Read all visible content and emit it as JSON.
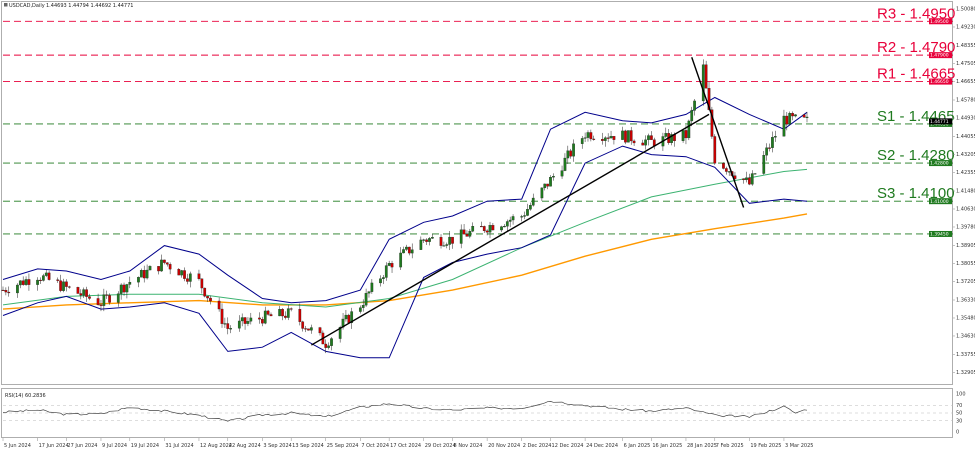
{
  "header": {
    "symbol": "USDCAD,Daily",
    "ohlc": "1.44693 1.44794 1.44692 1.44771",
    "rsi_label": "RSI(14) 60.2836"
  },
  "colors": {
    "resistance": "#e8003a",
    "support": "#1f7a1f",
    "up_candle": "#1f7a1f",
    "down_candle": "#cc0000",
    "bollinger": "#00008b",
    "ma_fast": "#3cb371",
    "ma_slow": "#ff9900",
    "trendline": "#000000",
    "rsi_line": "#444444"
  },
  "chart_data": [
    {
      "type": "candlestick",
      "title": "USDCAD,Daily",
      "ylim": [
        1.3255,
        1.5008
      ],
      "price_axis_ticks": [
        "1.50080",
        "1.49230",
        "1.48355",
        "1.47505",
        "1.46655",
        "1.45780",
        "1.44930",
        "1.44055",
        "1.43205",
        "1.42355",
        "1.41480",
        "1.40630",
        "1.39780",
        "1.38905",
        "1.38055",
        "1.37205",
        "1.36330",
        "1.35480",
        "1.34630",
        "1.33755",
        "1.32905",
        "1.32055"
      ],
      "x_axis_labels": [
        "5 Jun 2024",
        "17 Jun 2024",
        "27 Jun 2024",
        "9 Jul 2024",
        "19 Jul 2024",
        "31 Jul 2024",
        "12 Aug 2024",
        "22 Aug 2024",
        "3 Sep 2024",
        "13 Sep 2024",
        "25 Sep 2024",
        "7 Oct 2024",
        "17 Oct 2024",
        "29 Oct 2024",
        "8 Nov 2024",
        "20 Nov 2024",
        "2 Dec 2024",
        "12 Dec 2024",
        "24 Dec 2024",
        "6 Jan 2025",
        "16 Jan 2025",
        "28 Jan 2025",
        "7 Feb 2025",
        "19 Feb 2025",
        "3 Mar 2025"
      ],
      "levels": [
        {
          "name": "R3",
          "label": "R3 - 1.4950",
          "value": 1.495,
          "tag": "1.49500",
          "kind": "resistance"
        },
        {
          "name": "R2",
          "label": "R2 - 1.4790",
          "value": 1.479,
          "tag": "1.47900",
          "kind": "resistance"
        },
        {
          "name": "R1",
          "label": "R1 - 1.4665",
          "value": 1.4665,
          "tag": "1.46650",
          "kind": "resistance"
        },
        {
          "name": "S1",
          "label": "S1 - 1.4465",
          "value": 1.4465,
          "tag": "1.44650",
          "kind": "support"
        },
        {
          "name": "S2",
          "label": "S2 - 1.4280",
          "value": 1.428,
          "tag": "1.42800",
          "kind": "support"
        },
        {
          "name": "S3",
          "label": "S3 - 1.4100",
          "value": 1.41,
          "tag": "1.41000",
          "kind": "support"
        },
        {
          "name": "L4",
          "label": "",
          "value": 1.3945,
          "tag": "1.39450",
          "kind": "support"
        }
      ],
      "current_price_tag": "1.44771",
      "price_path": [
        [
          "5 Jun 2024",
          1.368
        ],
        [
          "17 Jun 2024",
          1.375
        ],
        [
          "27 Jun 2024",
          1.369
        ],
        [
          "9 Jul 2024",
          1.362
        ],
        [
          "19 Jul 2024",
          1.372
        ],
        [
          "31 Jul 2024",
          1.381
        ],
        [
          "12 Aug 2024",
          1.372
        ],
        [
          "22 Aug 2024",
          1.35
        ],
        [
          "3 Sep 2024",
          1.355
        ],
        [
          "13 Sep 2024",
          1.357
        ],
        [
          "25 Sep 2024",
          1.343
        ],
        [
          "7 Oct 2024",
          1.361
        ],
        [
          "17 Oct 2024",
          1.38
        ],
        [
          "29 Oct 2024",
          1.392
        ],
        [
          "8 Nov 2024",
          1.392
        ],
        [
          "20 Nov 2024",
          1.398
        ],
        [
          "2 Dec 2024",
          1.403
        ],
        [
          "12 Dec 2024",
          1.42
        ],
        [
          "24 Dec 2024",
          1.442
        ],
        [
          "6 Jan 2025",
          1.441
        ],
        [
          "16 Jan 2025",
          1.438
        ],
        [
          "28 Jan 2025",
          1.441
        ],
        [
          "3 Feb 2025",
          1.473
        ],
        [
          "7 Feb 2025",
          1.43
        ],
        [
          "19 Feb 2025",
          1.418
        ],
        [
          "3 Mar 2025",
          1.449
        ],
        [
          "11 Mar 2025",
          1.4477
        ]
      ],
      "bollinger_upper": [
        [
          "5 Jun 2024",
          1.373
        ],
        [
          "17 Jun 2024",
          1.378
        ],
        [
          "27 Jun 2024",
          1.377
        ],
        [
          "9 Jul 2024",
          1.373
        ],
        [
          "19 Jul 2024",
          1.377
        ],
        [
          "31 Jul 2024",
          1.389
        ],
        [
          "12 Aug 2024",
          1.385
        ],
        [
          "22 Aug 2024",
          1.375
        ],
        [
          "3 Sep 2024",
          1.364
        ],
        [
          "13 Sep 2024",
          1.362
        ],
        [
          "25 Sep 2024",
          1.363
        ],
        [
          "7 Oct 2024",
          1.368
        ],
        [
          "17 Oct 2024",
          1.392
        ],
        [
          "29 Oct 2024",
          1.4
        ],
        [
          "8 Nov 2024",
          1.403
        ],
        [
          "20 Nov 2024",
          1.41
        ],
        [
          "2 Dec 2024",
          1.411
        ],
        [
          "12 Dec 2024",
          1.444
        ],
        [
          "24 Dec 2024",
          1.452
        ],
        [
          "6 Jan 2025",
          1.448
        ],
        [
          "16 Jan 2025",
          1.447
        ],
        [
          "28 Jan 2025",
          1.451
        ],
        [
          "7 Feb 2025",
          1.459
        ],
        [
          "19 Feb 2025",
          1.451
        ],
        [
          "3 Mar 2025",
          1.444
        ],
        [
          "11 Mar 2025",
          1.452
        ]
      ],
      "bollinger_lower": [
        [
          "5 Jun 2024",
          1.356
        ],
        [
          "17 Jun 2024",
          1.362
        ],
        [
          "27 Jun 2024",
          1.365
        ],
        [
          "9 Jul 2024",
          1.359
        ],
        [
          "19 Jul 2024",
          1.36
        ],
        [
          "31 Jul 2024",
          1.362
        ],
        [
          "12 Aug 2024",
          1.357
        ],
        [
          "22 Aug 2024",
          1.339
        ],
        [
          "3 Sep 2024",
          1.341
        ],
        [
          "13 Sep 2024",
          1.348
        ],
        [
          "25 Sep 2024",
          1.339
        ],
        [
          "7 Oct 2024",
          1.336
        ],
        [
          "17 Oct 2024",
          1.336
        ],
        [
          "29 Oct 2024",
          1.374
        ],
        [
          "8 Nov 2024",
          1.381
        ],
        [
          "20 Nov 2024",
          1.385
        ],
        [
          "2 Dec 2024",
          1.388
        ],
        [
          "12 Dec 2024",
          1.394
        ],
        [
          "24 Dec 2024",
          1.428
        ],
        [
          "6 Jan 2025",
          1.436
        ],
        [
          "16 Jan 2025",
          1.432
        ],
        [
          "28 Jan 2025",
          1.431
        ],
        [
          "7 Feb 2025",
          1.426
        ],
        [
          "19 Feb 2025",
          1.409
        ],
        [
          "3 Mar 2025",
          1.411
        ],
        [
          "11 Mar 2025",
          1.41
        ]
      ],
      "ma_fast": [
        [
          "5 Jun 2024",
          1.361
        ],
        [
          "27 Jun 2024",
          1.365
        ],
        [
          "19 Jul 2024",
          1.366
        ],
        [
          "12 Aug 2024",
          1.366
        ],
        [
          "3 Sep 2024",
          1.362
        ],
        [
          "25 Sep 2024",
          1.36
        ],
        [
          "17 Oct 2024",
          1.364
        ],
        [
          "8 Nov 2024",
          1.373
        ],
        [
          "2 Dec 2024",
          1.388
        ],
        [
          "24 Dec 2024",
          1.4
        ],
        [
          "16 Jan 2025",
          1.412
        ],
        [
          "7 Feb 2025",
          1.418
        ],
        [
          "3 Mar 2025",
          1.424
        ],
        [
          "11 Mar 2025",
          1.425
        ]
      ],
      "ma_slow": [
        [
          "5 Jun 2024",
          1.359
        ],
        [
          "27 Jun 2024",
          1.361
        ],
        [
          "19 Jul 2024",
          1.362
        ],
        [
          "12 Aug 2024",
          1.363
        ],
        [
          "3 Sep 2024",
          1.361
        ],
        [
          "25 Sep 2024",
          1.361
        ],
        [
          "17 Oct 2024",
          1.363
        ],
        [
          "8 Nov 2024",
          1.368
        ],
        [
          "2 Dec 2024",
          1.375
        ],
        [
          "24 Dec 2024",
          1.384
        ],
        [
          "16 Jan 2025",
          1.392
        ],
        [
          "7 Feb 2025",
          1.397
        ],
        [
          "3 Mar 2025",
          1.402
        ],
        [
          "11 Mar 2025",
          1.404
        ]
      ],
      "trendlines": [
        {
          "from": [
            "20 Sep 2024",
            1.342
          ],
          "to": [
            "5 Feb 2025",
            1.451
          ]
        },
        {
          "from": [
            "30 Jan 2025",
            1.478
          ],
          "to": [
            "17 Feb 2025",
            1.407
          ]
        }
      ]
    },
    {
      "type": "line",
      "title": "RSI(14) 60.2836",
      "ylim": [
        0,
        100
      ],
      "y_ticks": [
        100,
        70,
        50,
        30,
        0
      ],
      "values": [
        [
          "5 Jun 2024",
          52
        ],
        [
          "17 Jun 2024",
          58
        ],
        [
          "27 Jun 2024",
          46
        ],
        [
          "9 Jul 2024",
          48
        ],
        [
          "19 Jul 2024",
          65
        ],
        [
          "31 Jul 2024",
          55
        ],
        [
          "12 Aug 2024",
          44
        ],
        [
          "22 Aug 2024",
          28
        ],
        [
          "3 Sep 2024",
          45
        ],
        [
          "13 Sep 2024",
          50
        ],
        [
          "25 Sep 2024",
          40
        ],
        [
          "7 Oct 2024",
          65
        ],
        [
          "17 Oct 2024",
          75
        ],
        [
          "29 Oct 2024",
          62
        ],
        [
          "8 Nov 2024",
          58
        ],
        [
          "20 Nov 2024",
          63
        ],
        [
          "2 Dec 2024",
          63
        ],
        [
          "12 Dec 2024",
          82
        ],
        [
          "24 Dec 2024",
          70
        ],
        [
          "6 Jan 2025",
          60
        ],
        [
          "16 Jan 2025",
          55
        ],
        [
          "28 Jan 2025",
          63
        ],
        [
          "7 Feb 2025",
          44
        ],
        [
          "19 Feb 2025",
          40
        ],
        [
          "3 Mar 2025",
          67
        ],
        [
          "7 Mar 2025",
          50
        ],
        [
          "11 Mar 2025",
          60.28
        ]
      ]
    }
  ]
}
